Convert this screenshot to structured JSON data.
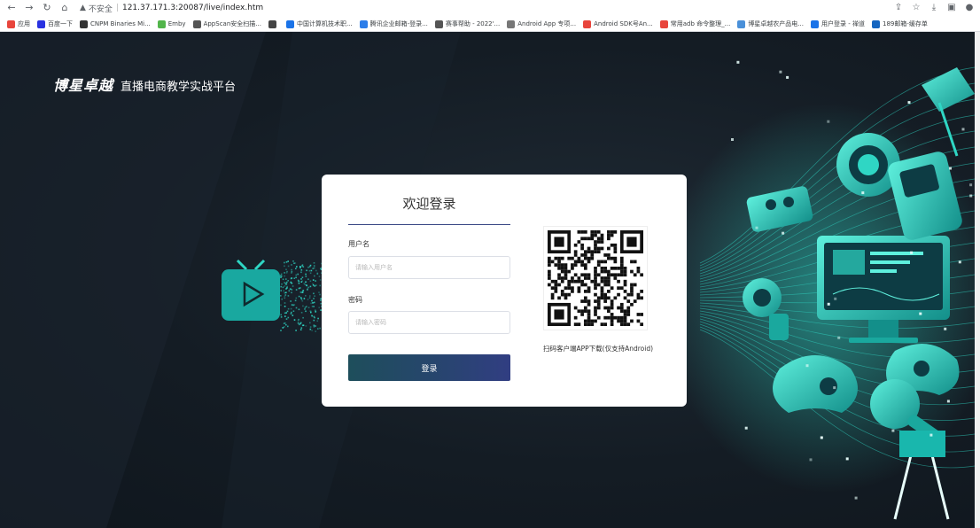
{
  "browser": {
    "security_label": "不安全",
    "url": "121.37.171.3:20087/live/index.htm",
    "bookmarks": [
      {
        "label": "应用",
        "color": "#e8453c"
      },
      {
        "label": "百度一下",
        "color": "#2932e1"
      },
      {
        "label": "CNPM Binaries Mi...",
        "color": "#333333"
      },
      {
        "label": "Emby",
        "color": "#52b54b"
      },
      {
        "label": "AppScan安全扫描...",
        "color": "#555555"
      },
      {
        "label": "",
        "color": "#444444"
      },
      {
        "label": "中国计算机技术职...",
        "color": "#1a73e8"
      },
      {
        "label": "腾讯企业邮箱-登录...",
        "color": "#2b7de9"
      },
      {
        "label": "赛事帮助 - 2022'...",
        "color": "#555555"
      },
      {
        "label": "Android App 专项...",
        "color": "#777777"
      },
      {
        "label": "Android SDK号An...",
        "color": "#e8453c"
      },
      {
        "label": "常用adb 命令整理_...",
        "color": "#e8453c"
      },
      {
        "label": "博星卓越农产品电...",
        "color": "#4a90d9"
      },
      {
        "label": "用户登录 - 禅道",
        "color": "#1a73e8"
      },
      {
        "label": "189邮箱-缓存单",
        "color": "#1565c0"
      }
    ]
  },
  "header": {
    "brand": "博星卓越",
    "subtitle": "直播电商教学实战平台"
  },
  "login": {
    "title": "欢迎登录",
    "username_label": "用户名",
    "username_placeholder": "请输入用户名",
    "username_value": "",
    "password_label": "密码",
    "password_placeholder": "请输入密码",
    "password_value": "",
    "submit_label": "登录",
    "qr_caption": "扫码客户端APP下载(仅支持Android)"
  },
  "colors": {
    "accent": "#3b4a86",
    "button_start": "#1e4e5b",
    "button_end": "#313e82",
    "teal": "#2fd6c4",
    "background": "#141c24"
  }
}
